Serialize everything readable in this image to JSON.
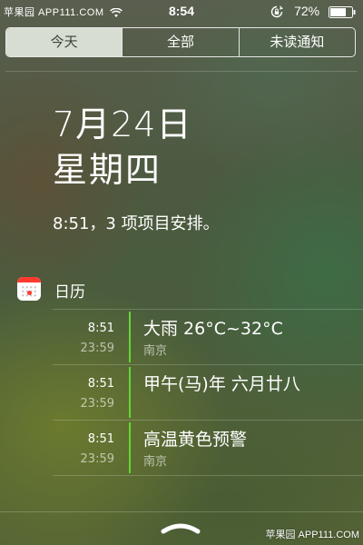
{
  "status_bar": {
    "carrier": "苹果园 APP111.COM",
    "time": "8:54",
    "battery_percent": "72%",
    "icons": [
      "wifi-icon",
      "rotation-lock-icon",
      "battery-icon"
    ]
  },
  "tabs": [
    {
      "label": "今天",
      "selected": true
    },
    {
      "label": "全部",
      "selected": false
    },
    {
      "label": "未读通知",
      "selected": false
    }
  ],
  "today": {
    "date": "7月24日",
    "weekday": "星期四",
    "summary": "8:51，3 项项目安排。"
  },
  "calendar_section": {
    "title": "日历",
    "icon": "calendar-icon",
    "accent_color": "#61d836",
    "events": [
      {
        "start": "8:51",
        "end": "23:59",
        "title": "大雨 26°C~32°C",
        "location": "南京"
      },
      {
        "start": "8:51",
        "end": "23:59",
        "title": "甲午(马)年 六月廿八",
        "location": ""
      },
      {
        "start": "8:51",
        "end": "23:59",
        "title": "高温黄色预警",
        "location": "南京"
      }
    ]
  },
  "watermark": "苹果园 APP111.COM"
}
